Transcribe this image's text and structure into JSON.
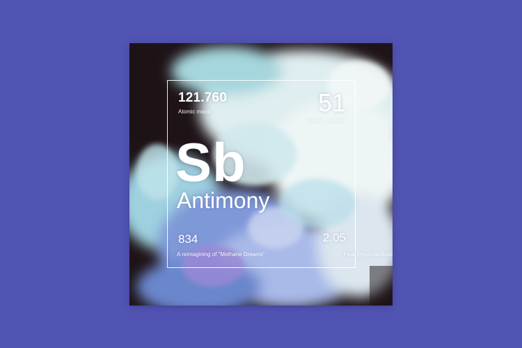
{
  "colors": {
    "background": "#5254b4",
    "card_dark": "#1e1317",
    "smoke_light": "#e9f3f3",
    "smoke_cyan": "#9dd3e0",
    "smoke_blue": "#6f8fd6",
    "smoke_purple": "#8a7fd0",
    "text": "#ffffff"
  },
  "element": {
    "atomic_mass": "121.760",
    "atomic_mass_label": "Atomic mass",
    "atomic_number": "51",
    "atomic_number_label": "Atomic number",
    "symbol": "Sb",
    "name": "Antimony",
    "bottom_left_value": "834",
    "bottom_right_value": "2.05",
    "bottom_left_caption": "A reimagining of \"Methane Dreams\"",
    "bottom_right_caption": "Feat @psicoactivati"
  }
}
